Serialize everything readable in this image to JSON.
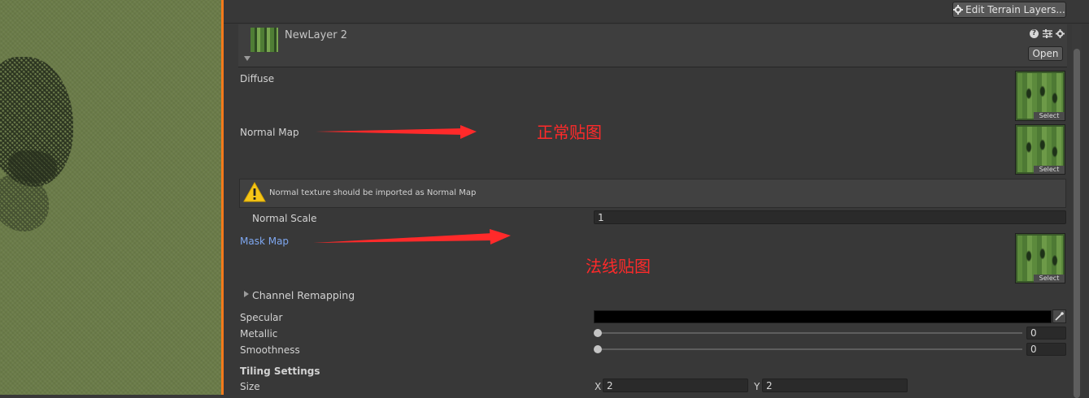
{
  "toolbar": {
    "edit_terrain_layers": "Edit Terrain Layers..."
  },
  "layer": {
    "name": "NewLayer 2",
    "open_label": "Open"
  },
  "textures": {
    "diffuse_label": "Diffuse",
    "normal_map_label": "Normal Map",
    "mask_map_label": "Mask Map",
    "select_label": "Select"
  },
  "warning": {
    "text": "Normal texture should be imported as Normal Map"
  },
  "normal_scale": {
    "label": "Normal Scale",
    "value": "1"
  },
  "channel_remapping": {
    "label": "Channel Remapping"
  },
  "specular": {
    "label": "Specular",
    "color": "#000000"
  },
  "metallic": {
    "label": "Metallic",
    "value": "0",
    "level": 0
  },
  "smoothness": {
    "label": "Smoothness",
    "value": "0",
    "level": 0
  },
  "tiling": {
    "heading": "Tiling Settings",
    "size_label": "Size",
    "x_label": "X",
    "x_value": "2",
    "y_label": "Y",
    "y_value": "2"
  },
  "annotations": {
    "normal_note": "正常贴图",
    "mask_note": "法线贴图"
  },
  "colors": {
    "accent_orange": "#f47a1b",
    "link_blue": "#7ea7f0",
    "annotation_red": "#ff2a2a",
    "warning_yellow": "#f5c518"
  },
  "icons": [
    "gear-icon",
    "help-icon",
    "preset-icon",
    "settings-icon",
    "foldout-arrow-icon",
    "warning-icon",
    "eyedropper-icon"
  ]
}
